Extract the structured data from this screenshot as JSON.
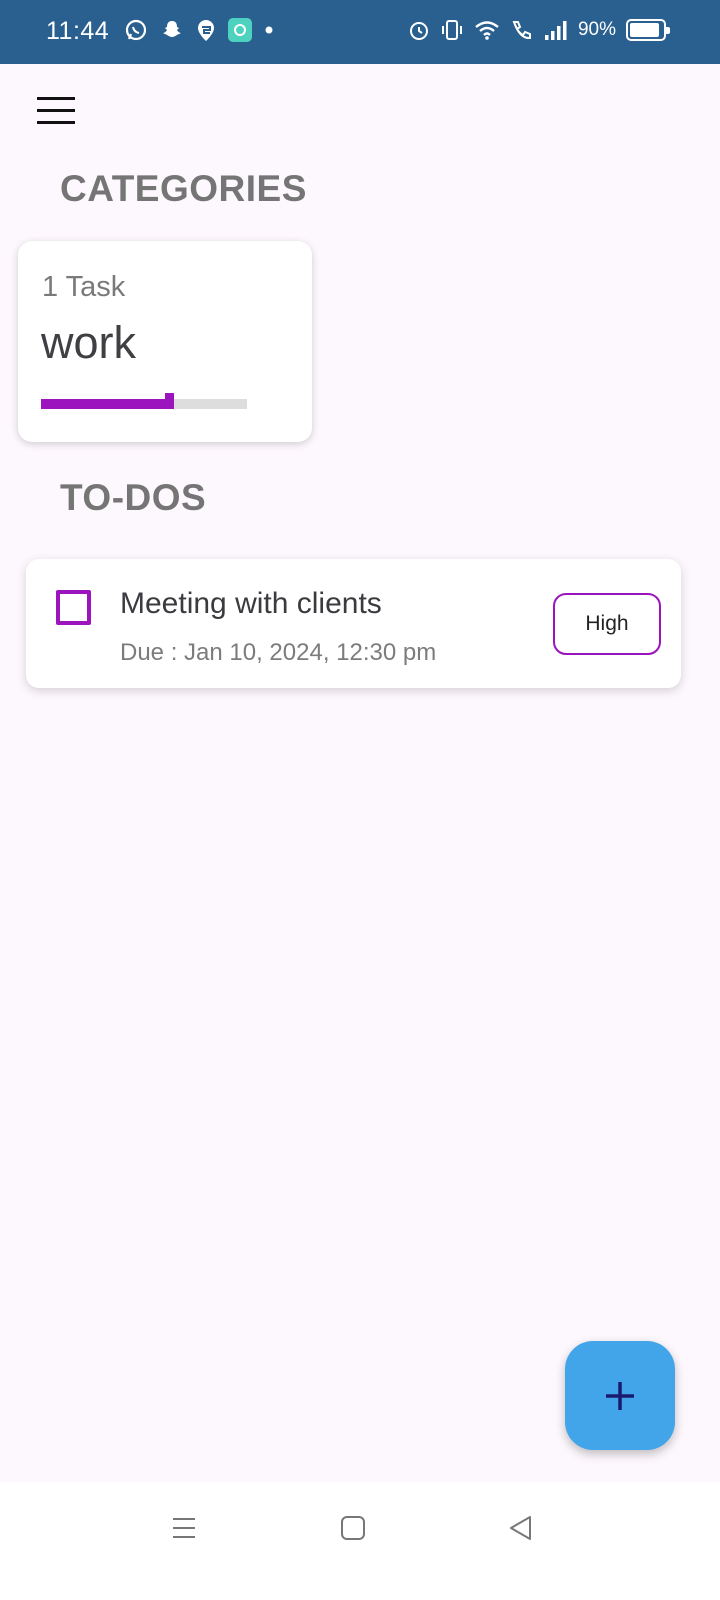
{
  "status_bar": {
    "time": "11:44",
    "left_icons": [
      "whatsapp-icon",
      "snapchat-icon",
      "swiggy-icon",
      "app-icon",
      "dot-icon"
    ],
    "right_icons": [
      "alarm-icon",
      "vibrate-icon",
      "wifi-icon",
      "wifi-call-icon",
      "signal-icon"
    ],
    "battery_percent": "90%",
    "battery_level": 0.9
  },
  "header": {
    "menu_icon": "hamburger-menu-icon"
  },
  "categories_section": {
    "title": "CATEGORIES",
    "items": [
      {
        "count_label": "1 Task",
        "name": "work",
        "progress": 0.62,
        "accent": "#9b14be"
      }
    ]
  },
  "todos_section": {
    "title": "TO-DOS",
    "items": [
      {
        "title": "Meeting with clients",
        "due": "Due : Jan 10, 2024, 12:30 pm",
        "priority": "High",
        "checked": false,
        "accent": "#9b14be"
      }
    ]
  },
  "fab": {
    "icon": "plus-icon",
    "color": "#42a5ea"
  },
  "nav_bar": {
    "buttons": [
      "recents-icon",
      "home-icon",
      "back-icon"
    ]
  }
}
